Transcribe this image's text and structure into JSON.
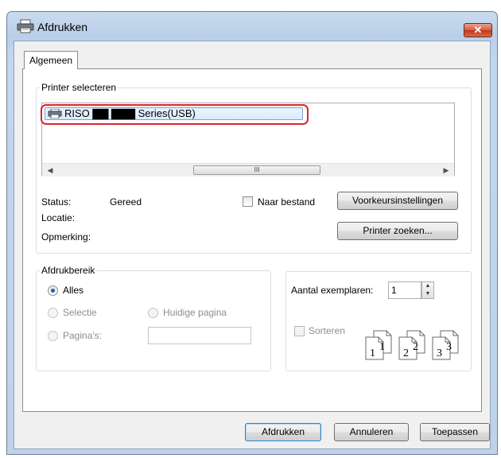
{
  "window": {
    "title": "Afdrukken",
    "close_symbol": "✕"
  },
  "tabs": [
    {
      "label": "Algemeen",
      "selected": true
    }
  ],
  "printer_section": {
    "legend": "Printer selecteren",
    "printers": [
      {
        "name": "RISO ▇▇ ▇▇▇ Series(USB)",
        "icon": "printer-icon",
        "selected": true
      }
    ],
    "scrollbar": {
      "thumb_grip": "III"
    },
    "status_label": "Status:",
    "status_value": "Gereed",
    "location_label": "Locatie:",
    "location_value": "",
    "comment_label": "Opmerking:",
    "comment_value": "",
    "print_to_file_label": "Naar bestand",
    "print_to_file_checked": false,
    "preferences_button": "Voorkeursinstellingen",
    "find_printer_button": "Printer zoeken..."
  },
  "page_range": {
    "legend": "Afdrukbereik",
    "all_label": "Alles",
    "selection_label": "Selectie",
    "current_page_label": "Huidige pagina",
    "pages_label": "Pagina's:",
    "pages_value": "",
    "selected": "all"
  },
  "copies": {
    "label": "Aantal exemplaren:",
    "value": "1",
    "collate_label": "Sorteren",
    "collate_checked": false,
    "collate_pages": [
      "1",
      "1",
      "2",
      "2",
      "3",
      "3"
    ]
  },
  "buttons": {
    "print": "Afdrukken",
    "cancel": "Annuleren",
    "apply": "Toepassen"
  },
  "colors": {
    "highlight": "#d9262c",
    "selection": "#dbeafd",
    "close_button": "#c7432a"
  }
}
